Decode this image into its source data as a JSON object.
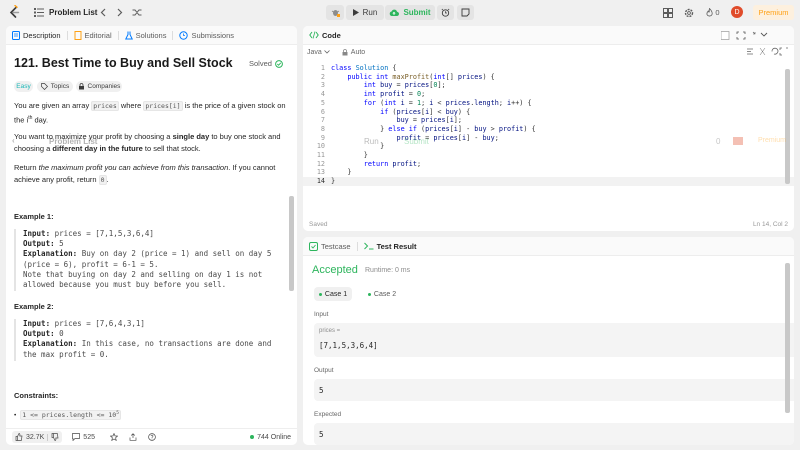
{
  "nav": {
    "title": "Problem List",
    "run": "Run",
    "submit": "Submit",
    "streak": "0",
    "avatar_letter": "D",
    "premium": "Premium"
  },
  "desc": {
    "tabs": [
      "Description",
      "Editorial",
      "Solutions",
      "Submissions"
    ],
    "title": "121. Best Time to Buy and Sell Stock",
    "solved": "Solved",
    "difficulty": "Easy",
    "topics": "Topics",
    "companies": "Companies",
    "p1a": "You are given an array ",
    "p1code1": "prices",
    "p1b": " where ",
    "p1code2": "prices[i]",
    "p1c": " is the price of a given stock on",
    "p1d": "the ",
    "p1sup_base": "i",
    "p1sup": "th",
    "p1e": " day.",
    "p2a": "You want to maximize your profit by choosing a ",
    "p2b": "single day",
    "p2c": " to buy one stock and",
    "p2d": "choosing a ",
    "p2e": "different day in the future",
    "p2f": " to sell that stock.",
    "p3a": "Return ",
    "p3b": "the maximum profit you can achieve from this transaction",
    "p3c": ". If you cannot",
    "p3d": "achieve any profit, return ",
    "p3code": "0",
    "p3e": ".",
    "ex1_title": "Example 1:",
    "ex1_input_label": "Input:",
    "ex1_input": " prices = [7,1,5,3,6,4]",
    "ex1_output_label": "Output:",
    "ex1_output": " 5",
    "ex1_expl_label": "Explanation:",
    "ex1_expl_1": " Buy on day 2 (price = 1) and sell on day 5",
    "ex1_expl_2": "(price = 6), profit = 6-1 = 5.",
    "ex1_expl_3": "Note that buying on day 2 and selling on day 1 is not",
    "ex1_expl_4": "allowed because you must buy before you sell.",
    "ex2_title": "Example 2:",
    "ex2_input_label": "Input:",
    "ex2_input": " prices = [7,6,4,3,1]",
    "ex2_output_label": "Output:",
    "ex2_output": " 0",
    "ex2_expl_label": "Explanation:",
    "ex2_expl_1": " In this case, no transactions are done and",
    "ex2_expl_2": "the max profit = 0.",
    "constraints_title": "Constraints:",
    "constraint1": "1 <= prices.length <= 10",
    "constraint1_sup": "5",
    "likes": "32.7K",
    "comments": "525",
    "online": "744 Online"
  },
  "code": {
    "tab": "Code",
    "language": "Java",
    "auto": "Auto",
    "saved": "Saved",
    "position": "Ln 14, Col 2",
    "line_numbers": [
      "1",
      "2",
      "3",
      "4",
      "5",
      "6",
      "7",
      "8",
      "9",
      "10",
      "11",
      "12",
      "13",
      "14"
    ]
  },
  "test": {
    "tab_testcase": "Testcase",
    "tab_result": "Test Result",
    "status": "Accepted",
    "runtime": "Runtime: 0 ms",
    "case1": "Case 1",
    "case2": "Case 2",
    "input_label": "Input",
    "param": "prices =",
    "param_value": "[7,1,5,3,6,4]",
    "output_label": "Output",
    "output_value": "5",
    "expected_label": "Expected",
    "expected_value": "5"
  },
  "ghost": {
    "title": "Problem List",
    "run": "Run",
    "submit": "Submit",
    "streak": "0",
    "premium": "Premium"
  },
  "colors": {
    "accent_green": "#2db55d",
    "accent_orange": "#ffa116",
    "avatar_red": "#e04c2b"
  }
}
